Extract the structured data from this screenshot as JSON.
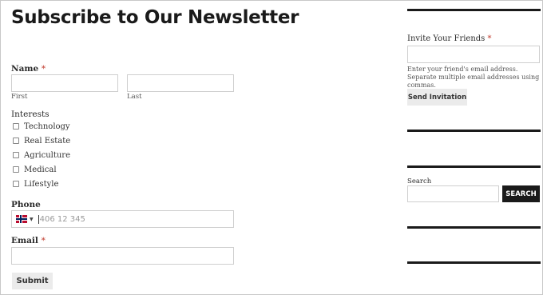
{
  "form": {
    "title": "Subscribe to Our Newsletter",
    "name": {
      "label": "Name",
      "required": "*",
      "first_sub": "First",
      "last_sub": "Last"
    },
    "interests": {
      "label": "Interests",
      "options": [
        "Technology",
        "Real Estate",
        "Agriculture",
        "Medical",
        "Lifestyle"
      ]
    },
    "phone": {
      "label": "Phone",
      "placeholder": "406 12 345",
      "country_icon": "norway-flag-icon"
    },
    "email": {
      "label": "Email",
      "required": "*"
    },
    "submit_label": "Submit"
  },
  "sidebar": {
    "invite": {
      "label": "Invite Your Friends",
      "required": "*",
      "help": "Enter your friend's email address. Separate multiple email addresses using commas.",
      "button_label": "Send Invitation"
    },
    "search": {
      "label": "Search",
      "button_label": "SEARCH"
    }
  },
  "colors": {
    "required": "#c0392b",
    "dark_button": "#1a1a1a",
    "light_button": "#ebebeb"
  }
}
